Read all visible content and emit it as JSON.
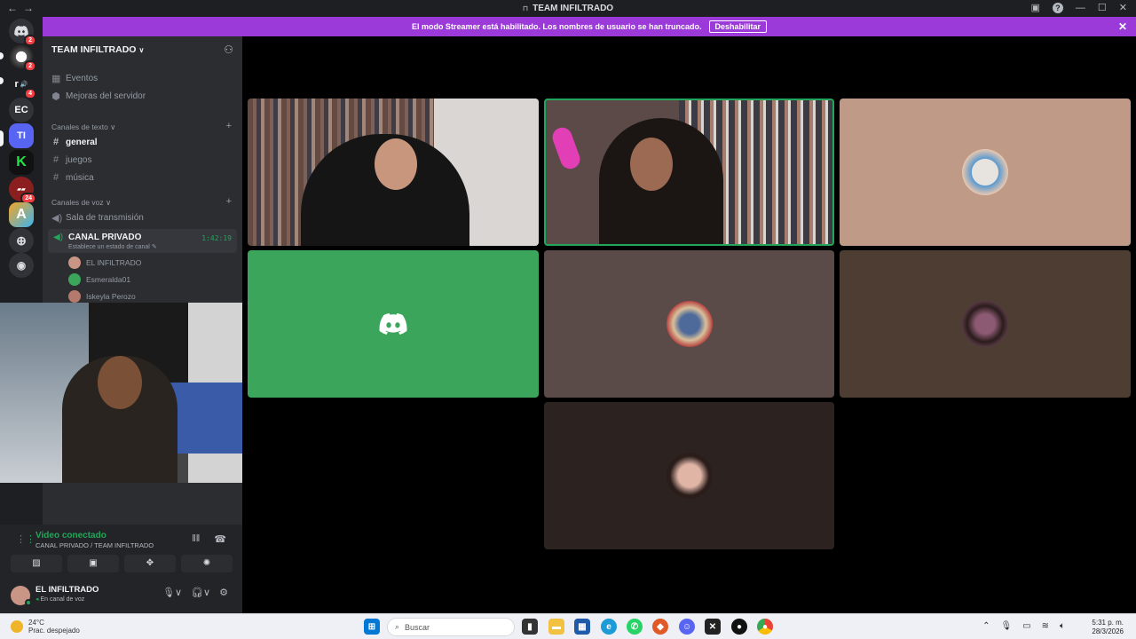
{
  "window": {
    "title": "TEAM INFILTRADO"
  },
  "banner": {
    "text": "El modo Streamer está habilitado. Los nombres de usuario se han truncado.",
    "button": "Deshabilitar"
  },
  "servers": [
    {
      "label": "",
      "badge": "2"
    },
    {
      "label": "",
      "badge": "2"
    },
    {
      "label": "r",
      "badge": "4"
    },
    {
      "label": "EC",
      "badge": ""
    },
    {
      "label": "TI",
      "badge": ""
    },
    {
      "label": "K",
      "badge": ""
    },
    {
      "label": "",
      "badge": "24"
    },
    {
      "label": "A",
      "badge": ""
    }
  ],
  "guild": {
    "name": "TEAM INFILTRADO"
  },
  "sidebar": {
    "top_items": [
      "Eventos",
      "Mejoras del servidor"
    ],
    "text_category": "Canales de texto",
    "text_channels": [
      "general",
      "juegos",
      "música"
    ],
    "voice_category": "Canales de voz",
    "voice_channels": [
      "Sala de transmisión"
    ],
    "active_voice": {
      "name": "CANAL PRIVADO",
      "status": "Establece un estado de canal",
      "timer": "1:42:19"
    },
    "voice_users": [
      "EL INFILTRADO",
      "Esmeralda01",
      "Iskeyla Perozo"
    ]
  },
  "rtc": {
    "status": "Video conectado",
    "location": "CANAL PRIVADO / TEAM INFILTRADO"
  },
  "user_panel": {
    "name": "EL INFILTRADO",
    "status": "En canal de voz"
  },
  "colors": {
    "accent": "#5865f2",
    "connected": "#23a55a",
    "banner": "#9b3ad8",
    "discord_green": "#3ba55c"
  },
  "taskbar": {
    "weather_temp": "24°C",
    "weather_desc": "Prac. despejado",
    "search": "Buscar",
    "time": "5:31 p. m.",
    "date": "28/3/2026"
  }
}
